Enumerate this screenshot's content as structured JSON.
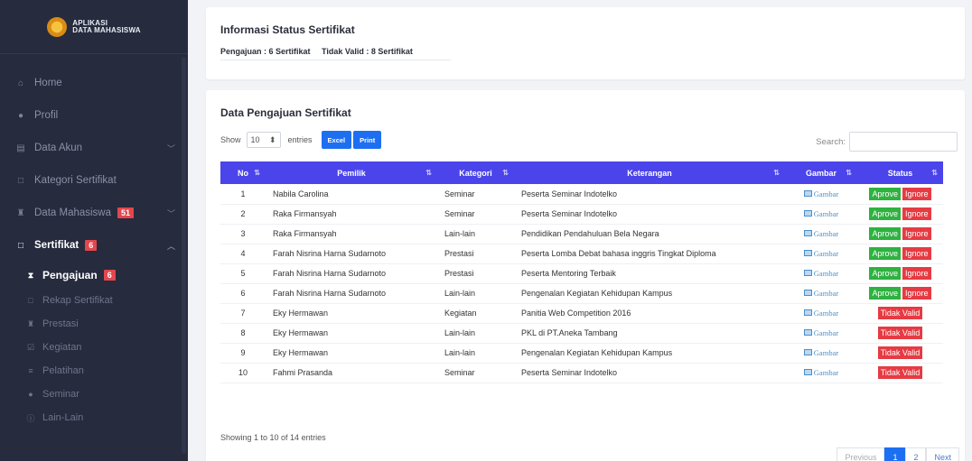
{
  "brand": {
    "line1": "APLIKASI",
    "line2": "DATA MAHASISWA"
  },
  "sidebar": {
    "items": [
      {
        "label": "Home",
        "icon": "home-icon"
      },
      {
        "label": "Profil",
        "icon": "user-icon"
      },
      {
        "label": "Data Akun",
        "icon": "database-icon"
      },
      {
        "label": "Kategori Sertifikat",
        "icon": "square-icon"
      },
      {
        "label": "Data Mahasiswa",
        "icon": "trophy-icon",
        "badge": "51"
      },
      {
        "label": "Sertifikat",
        "icon": "square-icon",
        "badge": "6"
      }
    ],
    "sub_items": [
      {
        "label": "Pengajuan",
        "icon": "hourglass-icon",
        "badge": "6"
      },
      {
        "label": "Rekap Sertifikat",
        "icon": "square-icon"
      },
      {
        "label": "Prestasi",
        "icon": "trophy-icon"
      },
      {
        "label": "Kegiatan",
        "icon": "check-square-icon"
      },
      {
        "label": "Pelatihan",
        "icon": "list-icon"
      },
      {
        "label": "Seminar",
        "icon": "circle-icon"
      },
      {
        "label": "Lain-Lain",
        "icon": "info-icon"
      }
    ]
  },
  "status_card": {
    "title": "Informasi Status Sertifikat",
    "pengajuan": "Pengajuan : 6 Sertifikat",
    "tidak_valid": "Tidak Valid : 8 Sertifikat"
  },
  "table_card": {
    "title": "Data Pengajuan Sertifikat",
    "show_label": "Show",
    "entries_value": "10",
    "entries_label": "entries",
    "excel_label": "Excel",
    "print_label": "Print",
    "search_label": "Search:",
    "columns": [
      "No",
      "Pemilik",
      "Kategori",
      "Keterangan",
      "Gambar",
      "Status"
    ],
    "rows": [
      {
        "no": "1",
        "pemilik": "Nabila Carolina",
        "kategori": "Seminar",
        "keterangan": "Peserta Seminar Indotelko",
        "gambar": "Gambar",
        "status": "pending"
      },
      {
        "no": "2",
        "pemilik": "Raka Firmansyah",
        "kategori": "Seminar",
        "keterangan": "Peserta Seminar Indotelko",
        "gambar": "Gambar",
        "status": "pending"
      },
      {
        "no": "3",
        "pemilik": "Raka Firmansyah",
        "kategori": "Lain-lain",
        "keterangan": "Pendidikan Pendahuluan Bela Negara",
        "gambar": "Gambar",
        "status": "pending"
      },
      {
        "no": "4",
        "pemilik": "Farah Nisrina Harna Sudarnoto",
        "kategori": "Prestasi",
        "keterangan": "Peserta Lomba Debat bahasa inggris Tingkat Diploma",
        "gambar": "Gambar",
        "status": "pending"
      },
      {
        "no": "5",
        "pemilik": "Farah Nisrina Harna Sudarnoto",
        "kategori": "Prestasi",
        "keterangan": "Peserta Mentoring Terbaik",
        "gambar": "Gambar",
        "status": "pending"
      },
      {
        "no": "6",
        "pemilik": "Farah Nisrina Harna Sudarnoto",
        "kategori": "Lain-lain",
        "keterangan": "Pengenalan Kegiatan Kehidupan Kampus",
        "gambar": "Gambar",
        "status": "pending"
      },
      {
        "no": "7",
        "pemilik": "Eky Hermawan",
        "kategori": "Kegiatan",
        "keterangan": "Panitia Web Competition 2016",
        "gambar": "Gambar",
        "status": "invalid"
      },
      {
        "no": "8",
        "pemilik": "Eky Hermawan",
        "kategori": "Lain-lain",
        "keterangan": "PKL di PT.Aneka Tambang",
        "gambar": "Gambar",
        "status": "invalid"
      },
      {
        "no": "9",
        "pemilik": "Eky Hermawan",
        "kategori": "Lain-lain",
        "keterangan": "Pengenalan Kegiatan Kehidupan Kampus",
        "gambar": "Gambar",
        "status": "invalid"
      },
      {
        "no": "10",
        "pemilik": "Fahmi Prasanda",
        "kategori": "Seminar",
        "keterangan": "Peserta Seminar Indotelko",
        "gambar": "Gambar",
        "status": "invalid"
      }
    ],
    "approve_label": "Aprove",
    "ignore_label": "Ignore",
    "invalid_label": "Tidak Valid",
    "showing_text": "Showing 1 to 10 of 14 entries",
    "pager": {
      "previous": "Previous",
      "page1": "1",
      "page2": "2",
      "next": "Next"
    }
  },
  "colors": {
    "sidebar_bg": "#262b3e",
    "header_bg": "#4a44ea",
    "approve": "#2eb240",
    "ignore": "#e63b43",
    "button": "#1d6ff2"
  }
}
